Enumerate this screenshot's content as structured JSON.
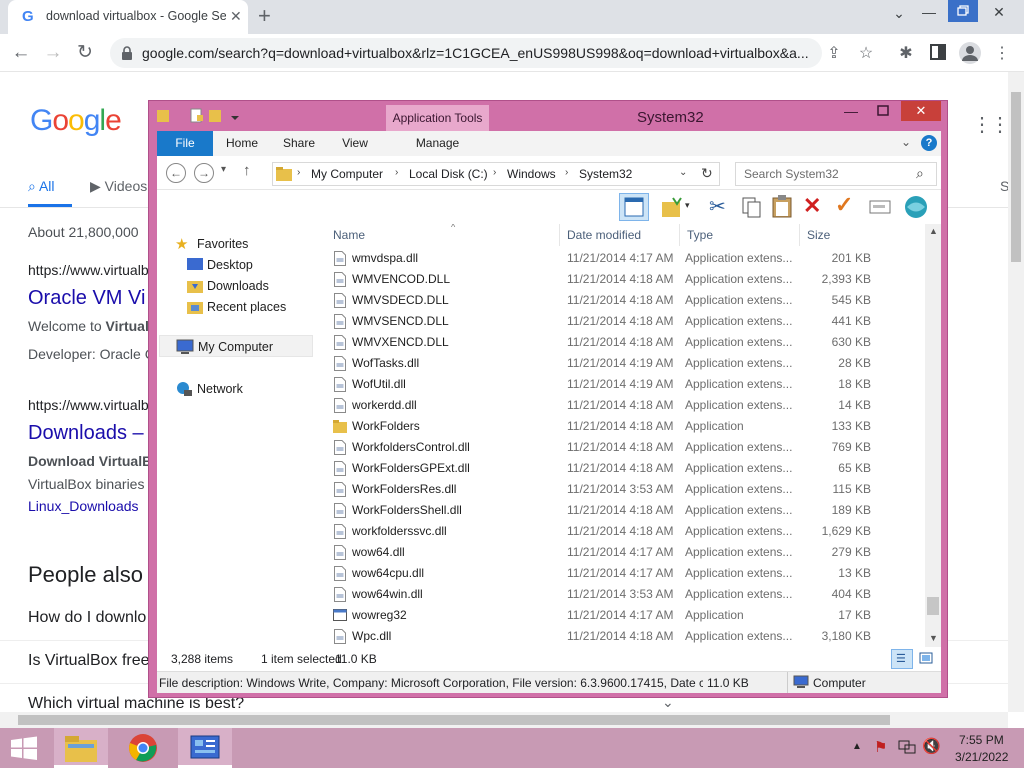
{
  "browser": {
    "tab_title": "download virtualbox - Google Se",
    "url": "google.com/search?q=download+virtualbox&rlz=1C1GCEA_enUS998US998&oq=download+virtualbox&a..."
  },
  "google": {
    "logo": "Google",
    "tab_all": "All",
    "tab_videos": "Videos",
    "tab_s": "S",
    "result_count": "About 21,800,000",
    "r1_url": "https://www.virtualb",
    "r1_title": "Oracle VM Vi",
    "r1_snip1": "Welcome to ",
    "r1_snip1_bold": "Virtual",
    "r1_snip2": "Developer: Oracle C",
    "r2_url": "https://www.virtualb",
    "r2_title": "Downloads –",
    "r2_snip1": "Download VirtualBo",
    "r2_snip2": "VirtualBox binaries",
    "r2_link": "Linux_Downloads",
    "paa_title": "People also a",
    "paa_q1": "How do I downlo",
    "paa_q2": "Is VirtualBox free",
    "paa_q3": "Which virtual machine is best?"
  },
  "explorer": {
    "title": "System32",
    "context_tab": "Application Tools",
    "tabs": {
      "file": "File",
      "home": "Home",
      "share": "Share",
      "view": "View",
      "manage": "Manage"
    },
    "breadcrumb": [
      "My Computer",
      "Local Disk (C:)",
      "Windows",
      "System32"
    ],
    "search_placeholder": "Search System32",
    "nav": {
      "favorites": "Favorites",
      "desktop": "Desktop",
      "downloads": "Downloads",
      "recent": "Recent places",
      "computer": "My Computer",
      "network": "Network"
    },
    "columns": {
      "name": "Name",
      "date": "Date modified",
      "type": "Type",
      "size": "Size"
    },
    "files": [
      {
        "name": "wmvdspa.dll",
        "date": "11/21/2014 4:17 AM",
        "type": "Application extens...",
        "size": "201 KB",
        "icon": "dll"
      },
      {
        "name": "WMVENCOD.DLL",
        "date": "11/21/2014 4:18 AM",
        "type": "Application extens...",
        "size": "2,393 KB",
        "icon": "dll"
      },
      {
        "name": "WMVSDECD.DLL",
        "date": "11/21/2014 4:18 AM",
        "type": "Application extens...",
        "size": "545 KB",
        "icon": "dll"
      },
      {
        "name": "WMVSENCD.DLL",
        "date": "11/21/2014 4:18 AM",
        "type": "Application extens...",
        "size": "441 KB",
        "icon": "dll"
      },
      {
        "name": "WMVXENCD.DLL",
        "date": "11/21/2014 4:18 AM",
        "type": "Application extens...",
        "size": "630 KB",
        "icon": "dll"
      },
      {
        "name": "WofTasks.dll",
        "date": "11/21/2014 4:19 AM",
        "type": "Application extens...",
        "size": "28 KB",
        "icon": "dll"
      },
      {
        "name": "WofUtil.dll",
        "date": "11/21/2014 4:19 AM",
        "type": "Application extens...",
        "size": "18 KB",
        "icon": "dll"
      },
      {
        "name": "workerdd.dll",
        "date": "11/21/2014 4:18 AM",
        "type": "Application extens...",
        "size": "14 KB",
        "icon": "dll"
      },
      {
        "name": "WorkFolders",
        "date": "11/21/2014 4:18 AM",
        "type": "Application",
        "size": "133 KB",
        "icon": "app-folder"
      },
      {
        "name": "WorkfoldersControl.dll",
        "date": "11/21/2014 4:18 AM",
        "type": "Application extens...",
        "size": "769 KB",
        "icon": "dll"
      },
      {
        "name": "WorkFoldersGPExt.dll",
        "date": "11/21/2014 4:18 AM",
        "type": "Application extens...",
        "size": "65 KB",
        "icon": "dll"
      },
      {
        "name": "WorkFoldersRes.dll",
        "date": "11/21/2014 3:53 AM",
        "type": "Application extens...",
        "size": "115 KB",
        "icon": "dll"
      },
      {
        "name": "WorkFoldersShell.dll",
        "date": "11/21/2014 4:18 AM",
        "type": "Application extens...",
        "size": "189 KB",
        "icon": "dll"
      },
      {
        "name": "workfolderssvc.dll",
        "date": "11/21/2014 4:18 AM",
        "type": "Application extens...",
        "size": "1,629 KB",
        "icon": "dll"
      },
      {
        "name": "wow64.dll",
        "date": "11/21/2014 4:17 AM",
        "type": "Application extens...",
        "size": "279 KB",
        "icon": "dll"
      },
      {
        "name": "wow64cpu.dll",
        "date": "11/21/2014 4:17 AM",
        "type": "Application extens...",
        "size": "13 KB",
        "icon": "dll"
      },
      {
        "name": "wow64win.dll",
        "date": "11/21/2014 3:53 AM",
        "type": "Application extens...",
        "size": "404 KB",
        "icon": "dll"
      },
      {
        "name": "wowreg32",
        "date": "11/21/2014 4:17 AM",
        "type": "Application",
        "size": "17 KB",
        "icon": "app"
      },
      {
        "name": "Wpc.dll",
        "date": "11/21/2014 4:18 AM",
        "type": "Application extens...",
        "size": "3,180 KB",
        "icon": "dll"
      }
    ],
    "status_items": "3,288 items",
    "status_selected": "1 item selected",
    "status_size": "11.0 KB",
    "desc_text": "File description: Windows Write, Company: Microsoft Corporation, File version: 6.3.9600.17415, Date cre",
    "desc_size": "11.0 KB",
    "desc_zone": "Computer"
  },
  "taskbar": {
    "time": "7:55 PM",
    "date": "3/21/2022"
  },
  "colors": {
    "window_frame": "#d070a8",
    "taskbar": "#c89ab4",
    "file_tab": "#1979ca",
    "google_link": "#1a0dab"
  }
}
